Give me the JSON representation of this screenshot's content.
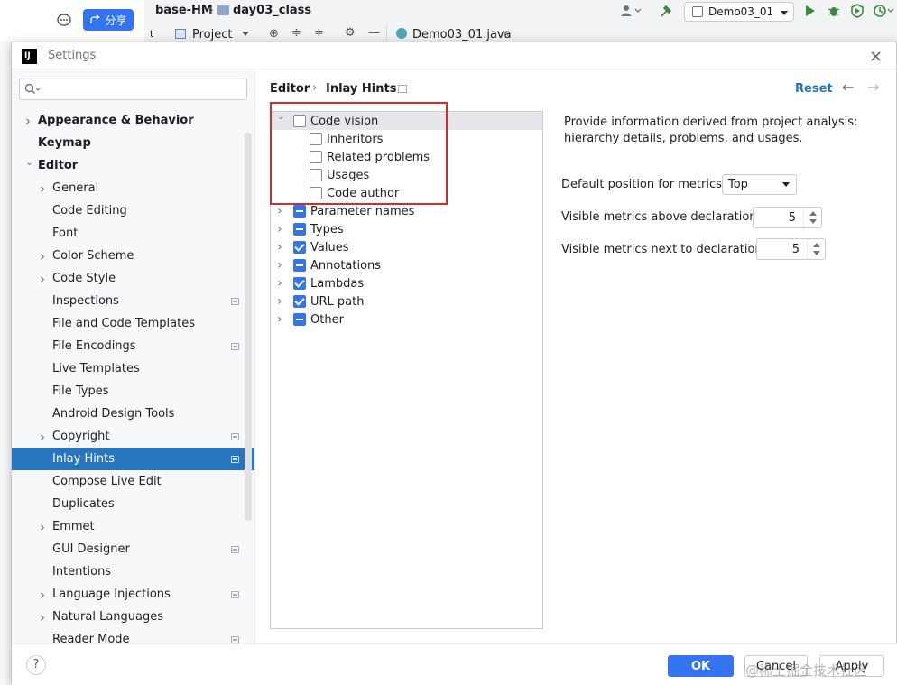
{
  "ide": {
    "share_label": "分享",
    "project": "base-HM",
    "folder": "day03_class",
    "run_config": "Demo03_01",
    "tool_tab": "Project",
    "file_tab": "Demo03_01.java",
    "side_tab_letter": "t"
  },
  "dialog": {
    "app_icon": "IJ",
    "title": "Settings",
    "close": "✕"
  },
  "sidebar": {
    "search_placeholder": "",
    "items": [
      {
        "label": "Appearance & Behavior",
        "bold": true,
        "chevron": "right"
      },
      {
        "label": "Keymap",
        "bold": true
      },
      {
        "label": "Editor",
        "bold": true,
        "chevron": "down"
      },
      {
        "label": "General",
        "chevron": "right"
      },
      {
        "label": "Code Editing"
      },
      {
        "label": "Font"
      },
      {
        "label": "Color Scheme",
        "chevron": "right"
      },
      {
        "label": "Code Style",
        "chevron": "right"
      },
      {
        "label": "Inspections",
        "project_icon": true
      },
      {
        "label": "File and Code Templates"
      },
      {
        "label": "File Encodings",
        "project_icon": true
      },
      {
        "label": "Live Templates"
      },
      {
        "label": "File Types"
      },
      {
        "label": "Android Design Tools"
      },
      {
        "label": "Copyright",
        "chevron": "right",
        "project_icon": true
      },
      {
        "label": "Inlay Hints",
        "selected": true,
        "project_icon": true
      },
      {
        "label": "Compose Live Edit"
      },
      {
        "label": "Duplicates"
      },
      {
        "label": "Emmet",
        "chevron": "right"
      },
      {
        "label": "GUI Designer",
        "project_icon": true
      },
      {
        "label": "Intentions"
      },
      {
        "label": "Language Injections",
        "chevron": "right",
        "project_icon": true
      },
      {
        "label": "Natural Languages",
        "chevron": "right"
      },
      {
        "label": "Reader Mode",
        "project_icon": true
      }
    ]
  },
  "breadcrumb": {
    "parent": "Editor",
    "separator": "›",
    "current": "Inlay Hints"
  },
  "reset_label": "Reset",
  "hints": [
    {
      "label": "Code vision",
      "state": "unchecked",
      "chevron": "down",
      "level": 0,
      "highlighted": true
    },
    {
      "label": "Inheritors",
      "state": "unchecked",
      "level": 1
    },
    {
      "label": "Related problems",
      "state": "unchecked",
      "level": 1
    },
    {
      "label": "Usages",
      "state": "unchecked",
      "level": 1
    },
    {
      "label": "Code author",
      "state": "unchecked",
      "level": 1
    },
    {
      "label": "Parameter names",
      "state": "partial",
      "chevron": "right",
      "level": 0
    },
    {
      "label": "Types",
      "state": "partial",
      "chevron": "right",
      "level": 0
    },
    {
      "label": "Values",
      "state": "checked",
      "chevron": "right",
      "level": 0
    },
    {
      "label": "Annotations",
      "state": "partial",
      "chevron": "right",
      "level": 0
    },
    {
      "label": "Lambdas",
      "state": "checked",
      "chevron": "right",
      "level": 0
    },
    {
      "label": "URL path",
      "state": "checked",
      "chevron": "right",
      "level": 0
    },
    {
      "label": "Other",
      "state": "partial",
      "chevron": "right",
      "level": 0
    }
  ],
  "details": {
    "description_line1": "Provide information derived from project analysis:",
    "description_line2": "hierarchy details, problems, and usages.",
    "position_label": "Default position for metrics:",
    "position_value": "Top",
    "above_label": "Visible metrics above declaration:",
    "above_value": "5",
    "next_label": "Visible metrics next to declaration:",
    "next_value": "5"
  },
  "footer": {
    "help": "?",
    "ok": "OK",
    "cancel": "Cancel",
    "apply": "Apply"
  },
  "watermark": "@稀土掘金技术社区",
  "colors": {
    "accent": "#3574f0",
    "selection": "#2675bf",
    "annotation_red": "#d62b2b"
  }
}
